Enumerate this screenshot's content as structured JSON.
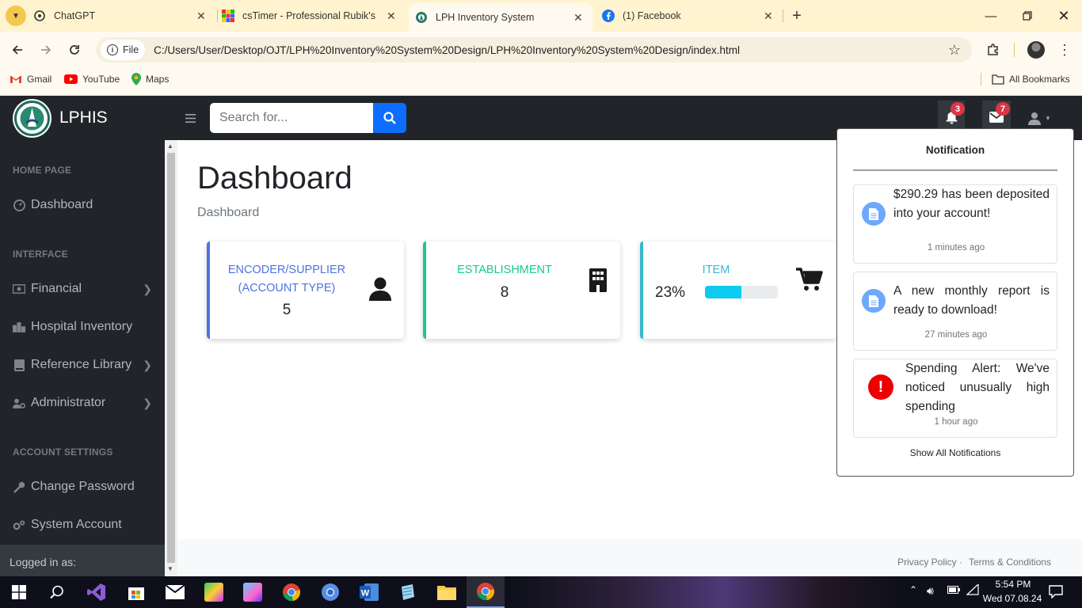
{
  "browser": {
    "tabs": [
      {
        "title": "ChatGPT"
      },
      {
        "title": "csTimer - Professional Rubik's C"
      },
      {
        "title": "LPH Inventory System"
      },
      {
        "title": "(1) Facebook"
      }
    ],
    "address": {
      "scheme": "File",
      "url": "C:/Users/User/Desktop/OJT/LPH%20Inventory%20System%20Design/LPH%20Inventory%20System%20Design/index.html"
    },
    "bookmarks": [
      {
        "label": "Gmail"
      },
      {
        "label": "YouTube"
      },
      {
        "label": "Maps"
      }
    ],
    "all_bookmarks": "All Bookmarks"
  },
  "app": {
    "brand": "LPHIS",
    "search_placeholder": "Search for...",
    "alerts_count": "3",
    "messages_count": "7",
    "sidebar": {
      "sections": [
        "HOME PAGE",
        "INTERFACE",
        "ACCOUNT SETTINGS"
      ],
      "items": [
        {
          "label": "Dashboard",
          "icon": "tachometer-icon"
        },
        {
          "label": "Financial",
          "icon": "money-icon"
        },
        {
          "label": "Hospital Inventory",
          "icon": "building-icon"
        },
        {
          "label": "Reference Library",
          "icon": "book-icon"
        },
        {
          "label": "Administrator",
          "icon": "user-cog-icon"
        },
        {
          "label": "Change Password",
          "icon": "key-icon"
        },
        {
          "label": "System Account",
          "icon": "cogs-icon"
        }
      ],
      "footer_label": "Logged in as:"
    },
    "page_title": "Dashboard",
    "breadcrumb": "Dashboard",
    "cards": [
      {
        "title": "ENCODER/SUPPLIER (ACCOUNT TYPE)",
        "value": "5",
        "accent": "#4e73df",
        "icon": "user-icon"
      },
      {
        "title": "ESTABLISHMENT",
        "value": "8",
        "accent": "#1cc88a",
        "icon": "building-icon"
      },
      {
        "title": "ITEM",
        "value": "23%",
        "accent": "#36b9cc",
        "icon": "cart-icon",
        "progress": 0.5
      }
    ],
    "notifications": {
      "header": "Notification",
      "items": [
        {
          "text": "$290.29 has been deposited into your account!",
          "time": "1 minutes ago",
          "icon": "file-icon"
        },
        {
          "text": "A new monthly report is ready to download!",
          "time": "27 minutes ago",
          "icon": "file-icon"
        },
        {
          "text": "Spending Alert: We've noticed unusually high spending",
          "time": "1 hour ago",
          "icon": "exclamation-icon"
        }
      ],
      "footer": "Show All Notifications"
    },
    "footer_links": [
      "Privacy Policy",
      "Terms & Conditions"
    ]
  },
  "taskbar": {
    "time": "5:54 PM",
    "date": "Wed 07.08.24"
  },
  "colors": {
    "nav": "#212529",
    "primary": "#0d6efd",
    "badge": "#dc3545",
    "info": "#0dcaf0"
  }
}
